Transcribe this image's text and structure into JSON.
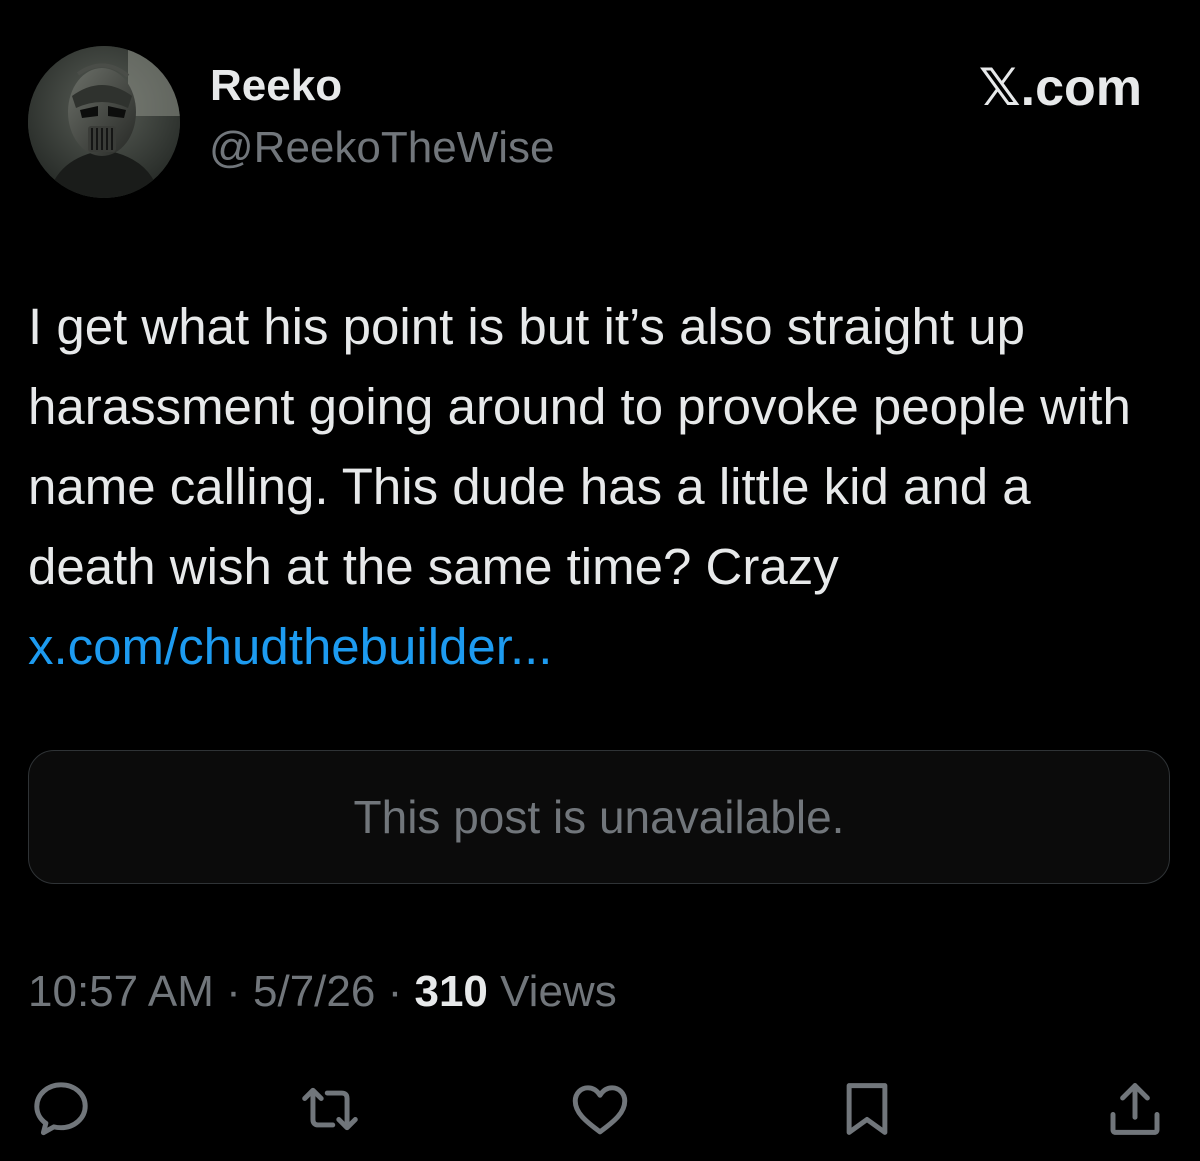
{
  "user": {
    "display_name": "Reeko",
    "handle": "@ReekoTheWise",
    "avatar_icon": "masked-warrior-avatar"
  },
  "brand": {
    "label": "𝕏.com"
  },
  "post": {
    "text": "I get what his point is but it’s also straight up harassment going around to provoke people with name calling. This dude has a little kid and a death wish at the same time? Crazy ",
    "link_text": "x.com/chudthebuilder..."
  },
  "quoted_post": {
    "unavailable_text": "This post is unavailable."
  },
  "meta": {
    "time": "10:57 AM",
    "separator": " · ",
    "date": "5/7/26",
    "views_count": "310",
    "views_label": " Views"
  },
  "actions": [
    {
      "name": "reply",
      "icon": "reply-icon"
    },
    {
      "name": "repost",
      "icon": "repost-icon"
    },
    {
      "name": "like",
      "icon": "heart-icon"
    },
    {
      "name": "bookmark",
      "icon": "bookmark-icon"
    },
    {
      "name": "share",
      "icon": "share-icon"
    }
  ],
  "colors": {
    "background": "#000000",
    "text_primary": "#e7e9ea",
    "text_secondary": "#71767b",
    "link": "#1d9bf0",
    "border": "#2f3336"
  }
}
